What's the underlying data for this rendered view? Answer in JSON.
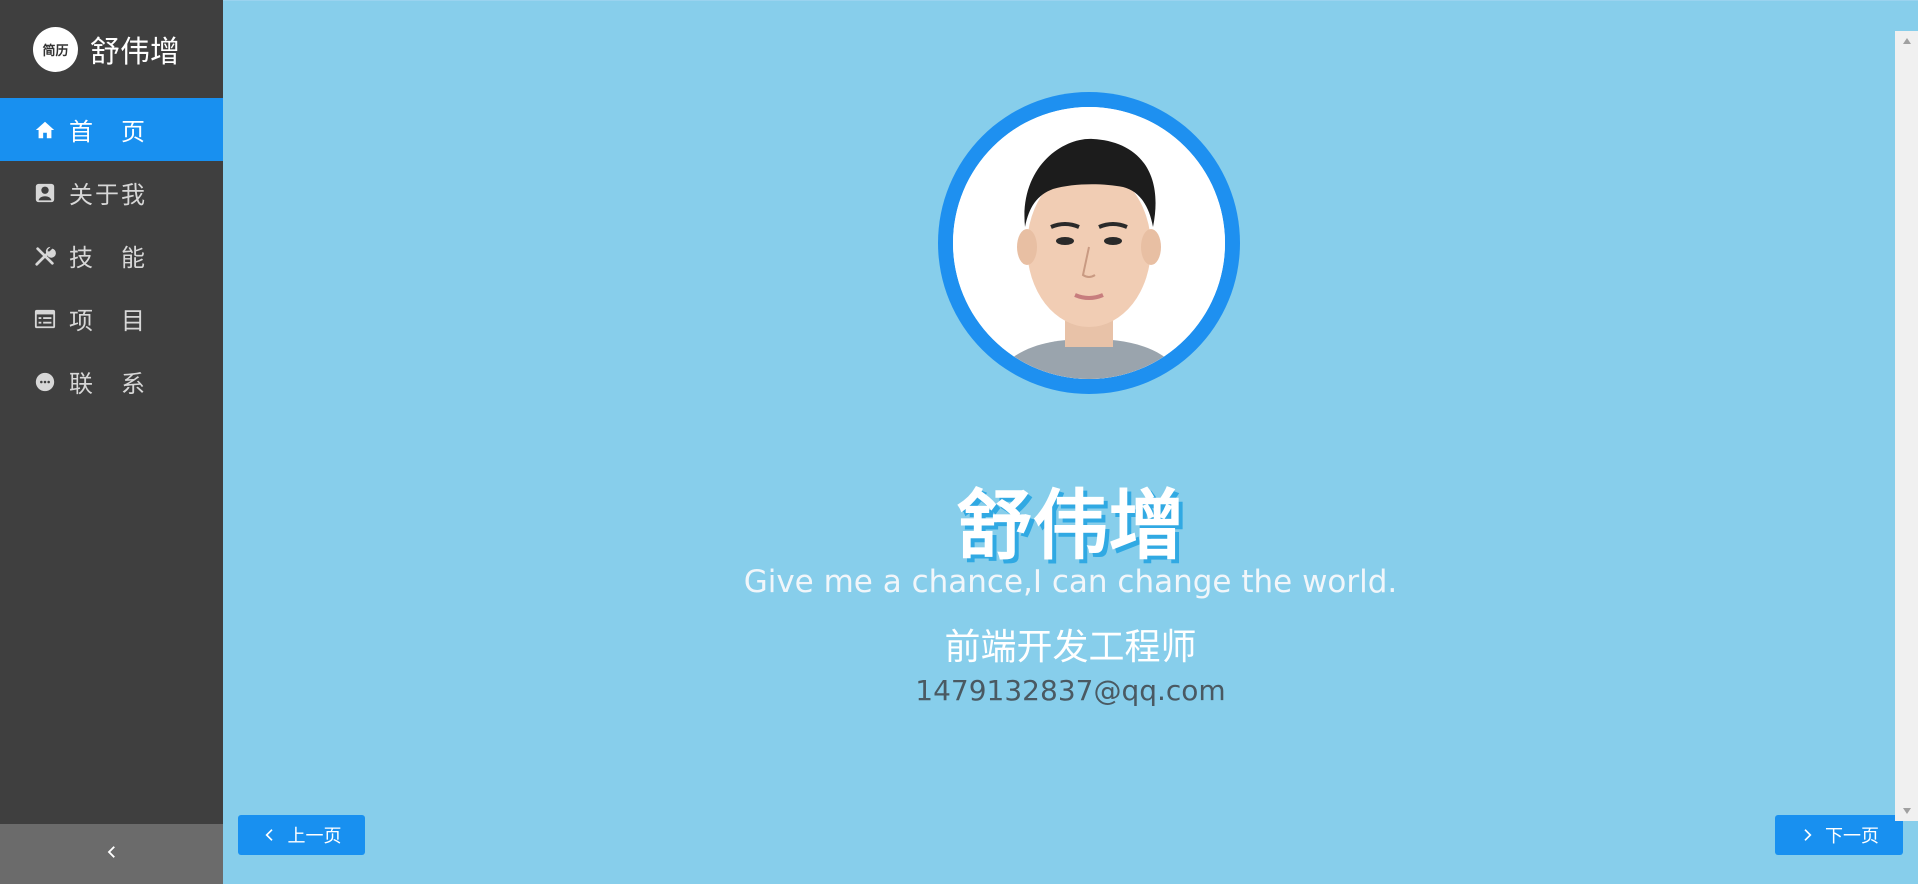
{
  "brand": {
    "logo_text": "简历",
    "name": "舒伟增"
  },
  "nav": {
    "items": [
      {
        "label": "首　页",
        "icon": "home-icon",
        "active": true
      },
      {
        "label": "关于我",
        "icon": "user-card-icon",
        "active": false
      },
      {
        "label": "技　能",
        "icon": "tools-icon",
        "active": false
      },
      {
        "label": "项　目",
        "icon": "list-icon",
        "active": false
      },
      {
        "label": "联　系",
        "icon": "chat-icon",
        "active": false
      }
    ]
  },
  "hero": {
    "name": "舒伟增",
    "tagline": "Give me a chance,I can change the world.",
    "role": "前端开发工程师",
    "email": "1479132837@qq.com"
  },
  "pager": {
    "prev_label": "上一页",
    "next_label": "下一页"
  },
  "colors": {
    "sidebar": "#3f3f3f",
    "accent": "#1890f0",
    "background": "#87ceeb"
  }
}
